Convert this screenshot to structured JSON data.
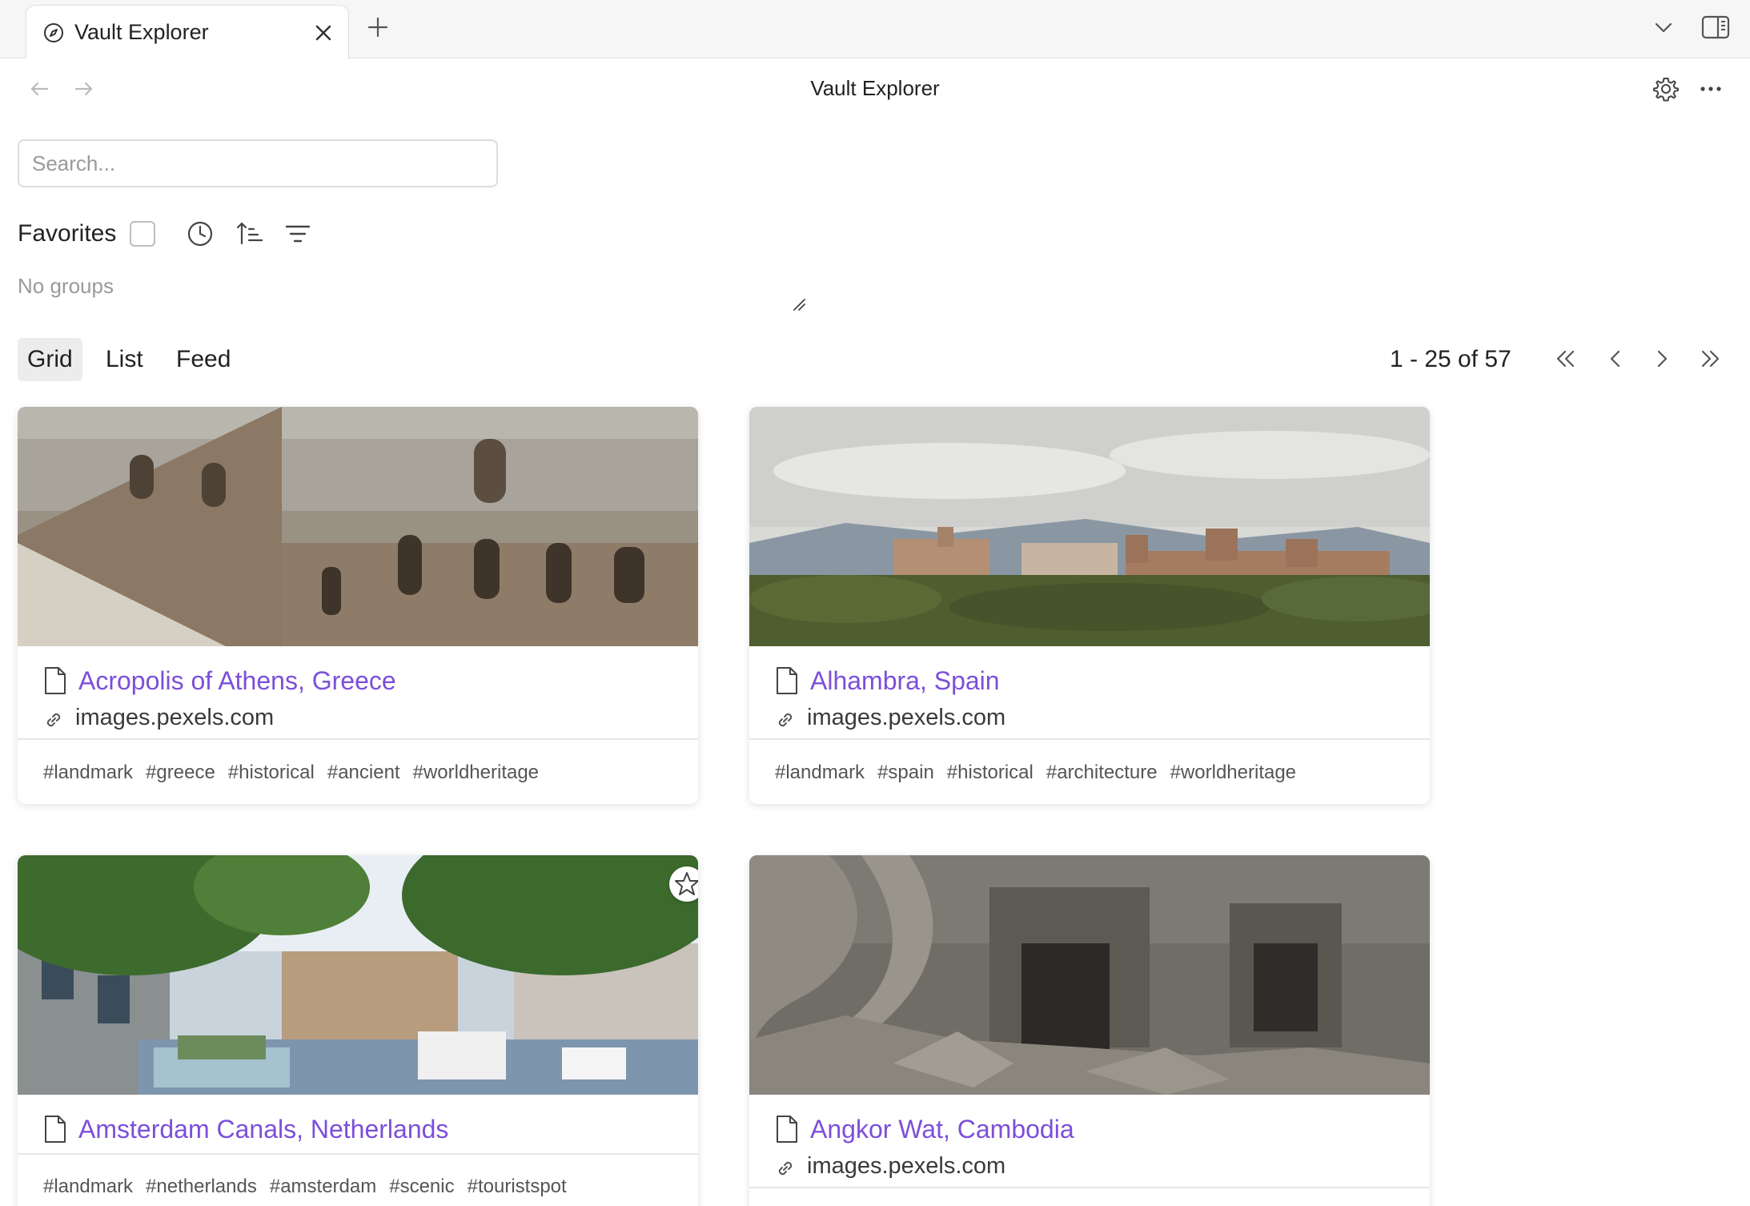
{
  "tab": {
    "title": "Vault Explorer",
    "icon": "compass-icon"
  },
  "header": {
    "title": "Vault Explorer"
  },
  "search": {
    "placeholder": "Search...",
    "value": ""
  },
  "filters": {
    "favorites_label": "Favorites",
    "favorites_checked": false,
    "no_groups": "No groups"
  },
  "views": {
    "grid": "Grid",
    "list": "List",
    "feed": "Feed",
    "active": "Grid"
  },
  "pagination": {
    "label": "1 - 25 of 57"
  },
  "colors": {
    "title_link": "#7c4fd9",
    "accent_bg": "#ececec"
  },
  "cards": [
    {
      "title": "Acropolis of Athens, Greece",
      "url": "images.pexels.com",
      "tags": [
        "#landmark",
        "#greece",
        "#historical",
        "#ancient",
        "#worldheritage"
      ],
      "favorite": false
    },
    {
      "title": "Alhambra, Spain",
      "url": "images.pexels.com",
      "tags": [
        "#landmark",
        "#spain",
        "#historical",
        "#architecture",
        "#worldheritage"
      ],
      "favorite": false
    },
    {
      "title": "Amsterdam Canals, Netherlands",
      "url": "",
      "tags": [
        "#landmark",
        "#netherlands",
        "#amsterdam",
        "#scenic",
        "#touristspot"
      ],
      "favorite": true
    },
    {
      "title": "Angkor Wat, Cambodia",
      "url": "images.pexels.com",
      "tags": [],
      "favorite": false
    }
  ]
}
